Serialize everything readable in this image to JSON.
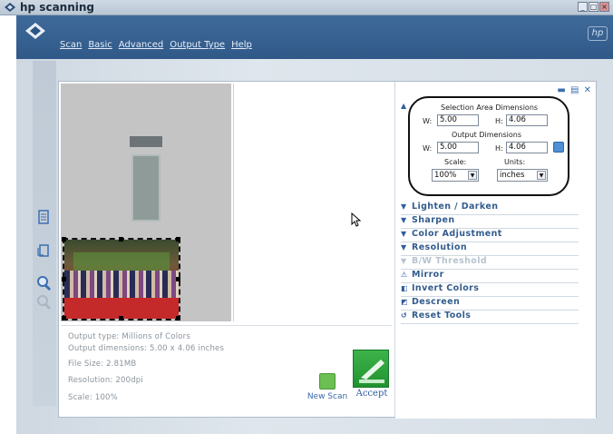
{
  "window": {
    "title": "hp scanning",
    "controls": [
      "minimize",
      "maximize",
      "close"
    ]
  },
  "menu": {
    "items": [
      "Scan",
      "Basic",
      "Advanced",
      "Output Type",
      "Help"
    ]
  },
  "selection_area": {
    "title": "Selection Area Dimensions",
    "w_label": "W:",
    "w_value": "5.00",
    "h_label": "H:",
    "h_value": "4.06"
  },
  "output_dimensions": {
    "title": "Output Dimensions",
    "w_label": "W:",
    "w_value": "5.00",
    "h_label": "H:",
    "h_value": "4.06"
  },
  "scale": {
    "label": "Scale:",
    "value": "100%"
  },
  "units": {
    "label": "Units:",
    "value": "inches"
  },
  "tools": [
    {
      "label": "Lighten / Darken",
      "icon": "triangle-down-icon",
      "enabled": true
    },
    {
      "label": "Sharpen",
      "icon": "triangle-down-icon",
      "enabled": true
    },
    {
      "label": "Color Adjustment",
      "icon": "triangle-down-icon",
      "enabled": true
    },
    {
      "label": "Resolution",
      "icon": "triangle-down-icon",
      "enabled": true
    },
    {
      "label": "B/W Threshold",
      "icon": "triangle-down-icon",
      "enabled": false
    },
    {
      "label": "Mirror",
      "icon": "mirror-icon",
      "enabled": true
    },
    {
      "label": "Invert Colors",
      "icon": "invert-icon",
      "enabled": true
    },
    {
      "label": "Descreen",
      "icon": "descreen-icon",
      "enabled": true
    },
    {
      "label": "Reset Tools",
      "icon": "reset-icon",
      "enabled": true
    }
  ],
  "info": {
    "output_type": "Output type: Millions of Colors",
    "output_dimensions": "Output dimensions: 5.00 x 4.06 inches",
    "file_size": "File Size: 2.81MB",
    "resolution": "Resolution: 200dpi",
    "scale": "Scale: 100%"
  },
  "actions": {
    "new_scan": "New Scan",
    "accept": "Accept"
  },
  "colors": {
    "header_blue": "#2d5584",
    "tool_text": "#335c8d",
    "accept_green": "#21922f"
  }
}
